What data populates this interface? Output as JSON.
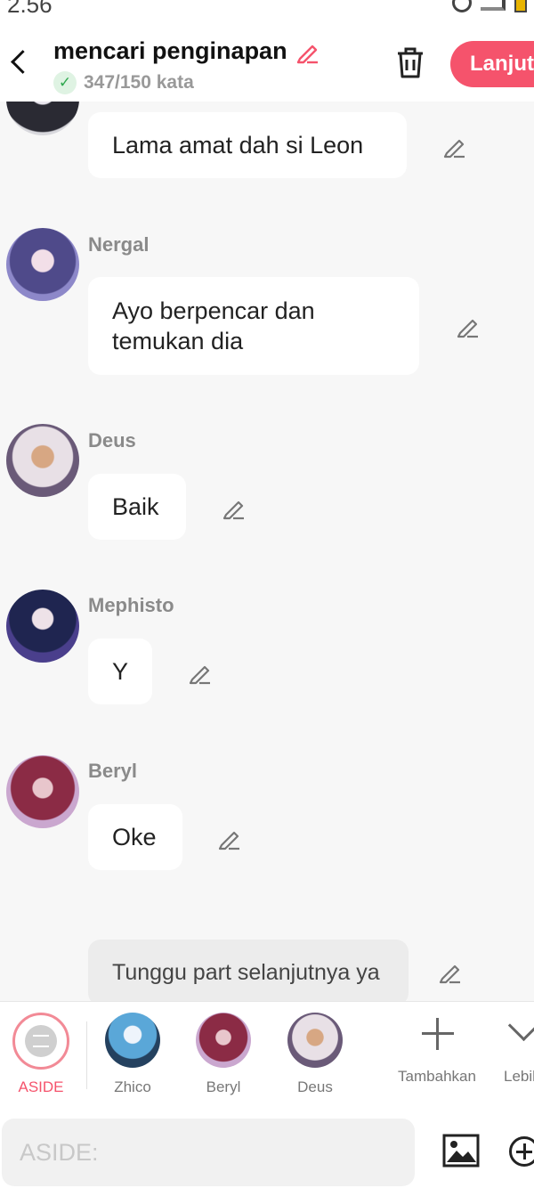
{
  "status": {
    "time": "2.56"
  },
  "header": {
    "title": "mencari penginapan",
    "word_count": "347/150 kata",
    "next_label": "Lanjut"
  },
  "messages": [
    {
      "speaker": "",
      "text": "Lama amat dah si Leon"
    },
    {
      "speaker": "Nergal",
      "text": "Ayo berpencar dan temukan dia"
    },
    {
      "speaker": "Deus",
      "text": "Baik"
    },
    {
      "speaker": "Mephisto",
      "text": "Y"
    },
    {
      "speaker": "Beryl",
      "text": "Oke"
    }
  ],
  "aside_message": "Tunggu part selanjutnya ya",
  "toolbar": {
    "aside_label": "ASIDE",
    "characters": [
      "Zhico",
      "Beryl",
      "Deus"
    ],
    "add_label": "Tambahkan",
    "more_label": "Lebih"
  },
  "input": {
    "placeholder": "ASIDE:"
  },
  "colors": {
    "accent": "#f5536c",
    "success": "#2fa84f"
  }
}
